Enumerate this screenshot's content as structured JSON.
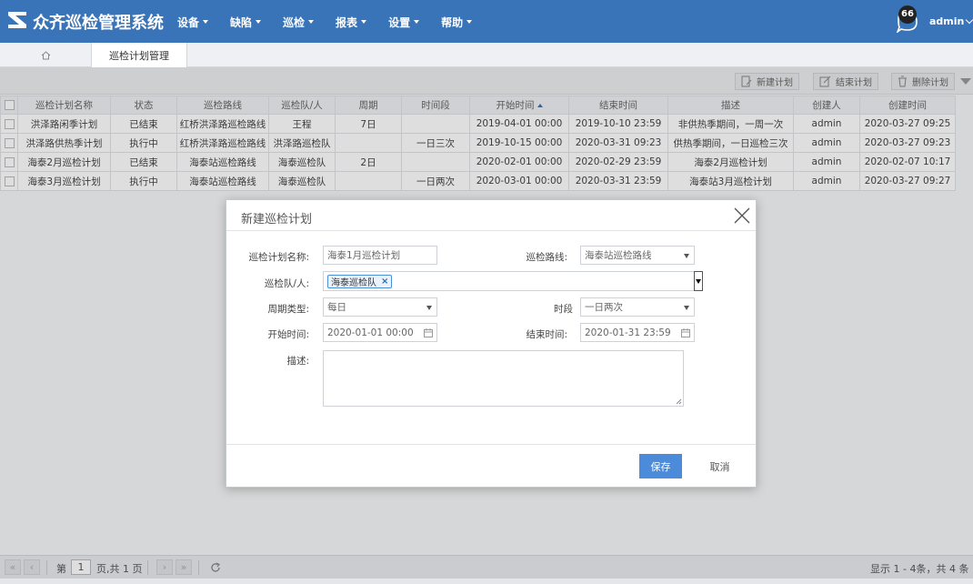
{
  "app": {
    "title": "众齐巡检管理系统"
  },
  "nav": [
    {
      "label": "设备"
    },
    {
      "label": "缺陷"
    },
    {
      "label": "巡检"
    },
    {
      "label": "报表"
    },
    {
      "label": "设置"
    },
    {
      "label": "帮助"
    }
  ],
  "header": {
    "message_count": "66",
    "user": "admin"
  },
  "tabs": {
    "active": "巡检计划管理"
  },
  "toolbar": {
    "new": "新建计划",
    "end": "结束计划",
    "delete": "删除计划"
  },
  "table": {
    "columns": [
      "巡检计划名称",
      "状态",
      "巡检路线",
      "巡检队/人",
      "周期",
      "时间段",
      "开始时间",
      "结束时间",
      "描述",
      "创建人",
      "创建时间"
    ],
    "rows": [
      [
        "洪泽路闲季计划",
        "已结束",
        "红桥洪泽路巡检路线",
        "王程",
        "7日",
        "",
        "2019-04-01 00:00",
        "2019-10-10 23:59",
        "非供热季期间，一周一次",
        "admin",
        "2020-03-27 09:25"
      ],
      [
        "洪泽路供热季计划",
        "执行中",
        "红桥洪泽路巡检路线",
        "洪泽路巡检队",
        "",
        "一日三次",
        "2019-10-15 00:00",
        "2020-03-31 09:23",
        "供热季期间，一日巡检三次",
        "admin",
        "2020-03-27 09:23"
      ],
      [
        "海泰2月巡检计划",
        "已结束",
        "海泰站巡检路线",
        "海泰巡检队",
        "2日",
        "",
        "2020-02-01 00:00",
        "2020-02-29 23:59",
        "海泰2月巡检计划",
        "admin",
        "2020-02-07 10:17"
      ],
      [
        "海泰3月巡检计划",
        "执行中",
        "海泰站巡检路线",
        "海泰巡检队",
        "",
        "一日两次",
        "2020-03-01 00:00",
        "2020-03-31 23:59",
        "海泰站3月巡检计划",
        "admin",
        "2020-03-27 09:27"
      ]
    ]
  },
  "pager": {
    "page_label": "第",
    "page": "1",
    "of_label": "页,共 1 页",
    "summary": "显示 1 - 4条，共 4 条"
  },
  "modal": {
    "title": "新建巡检计划",
    "name_label": "巡检计划名称:",
    "name_value": "海泰1月巡检计划",
    "route_label": "巡检路线:",
    "route_value": "海泰站巡检路线",
    "team_label": "巡检队/人:",
    "team_tag": "海泰巡检队",
    "cycle_label": "周期类型:",
    "cycle_value": "每日",
    "period_label": "时段",
    "period_value": "一日两次",
    "start_label": "开始时间:",
    "start_value": "2020-01-01 00:00",
    "end_label": "结束时间:",
    "end_value": "2020-01-31 23:59",
    "desc_label": "描述:",
    "save": "保存",
    "cancel": "取消"
  },
  "colors": {
    "header": "#3a74b8",
    "primary_button": "#4b8bd9",
    "status_ended": "#d9302c",
    "status_running": "#2b56d4"
  },
  "icons": [
    "logo-icon",
    "caret-down-icon",
    "message-icon",
    "chevron-down-icon",
    "home-icon",
    "new-plan-icon",
    "end-plan-icon",
    "delete-icon",
    "close-icon",
    "calendar-icon",
    "refresh-icon"
  ]
}
